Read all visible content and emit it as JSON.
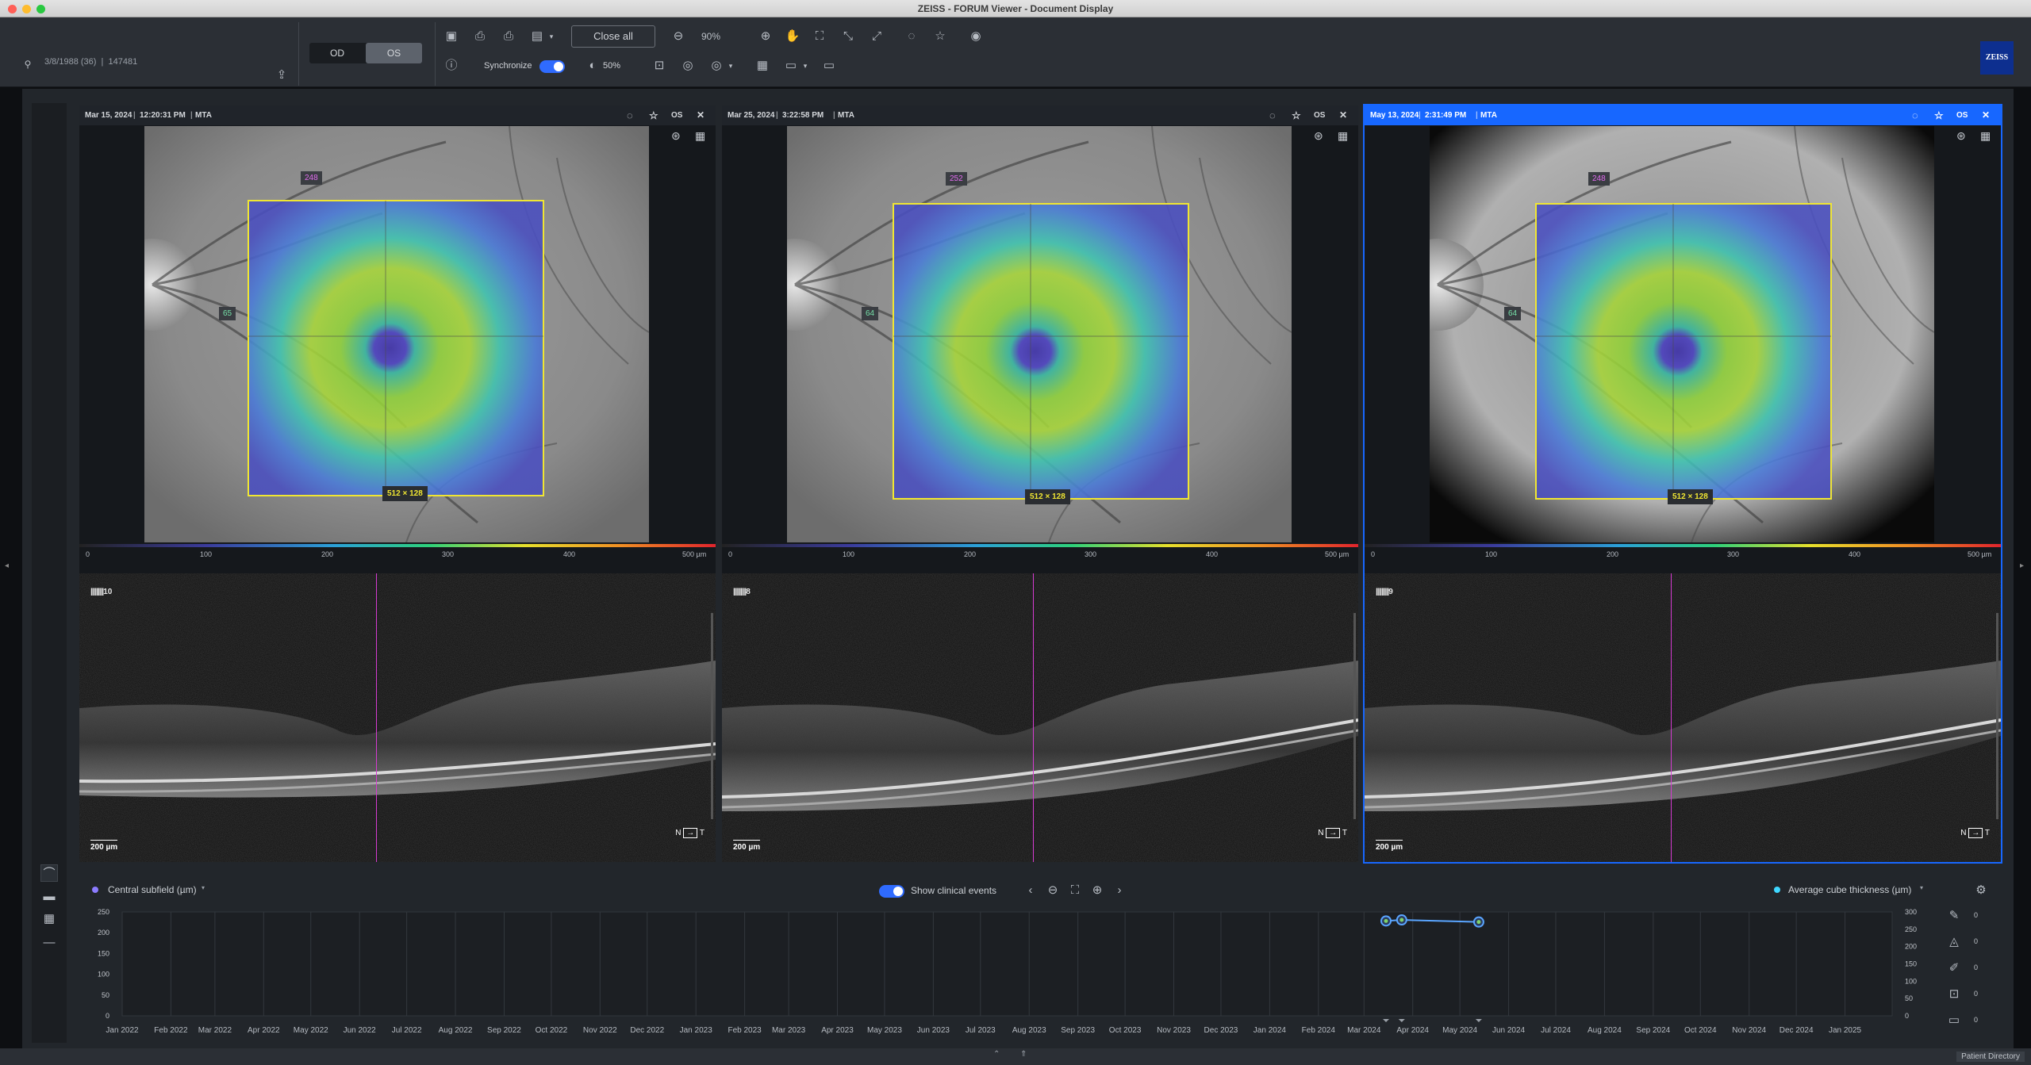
{
  "window": {
    "title": "ZEISS - FORUM Viewer - Document Display"
  },
  "patient": {
    "info": "3/8/1988 (36)  |  147481"
  },
  "eye_toggle": {
    "left": "OD",
    "right": "OS",
    "selected": "OS"
  },
  "toolbar": {
    "close_all": "Close all",
    "zoom": "90%",
    "synchronize": "Synchronize",
    "opacity": "50%"
  },
  "brand": {
    "logo": "ZEISS"
  },
  "panels": [
    {
      "date": "Mar 15, 2024",
      "time": "12:20:31 PM",
      "type": "MTA",
      "eye": "OS",
      "top_tag": "248",
      "left_tag": "65",
      "dim": "512 × 128",
      "bscan": "10",
      "selected": false
    },
    {
      "date": "Mar 25, 2024",
      "time": "3:22:58 PM",
      "type": "MTA",
      "eye": "OS",
      "top_tag": "252",
      "left_tag": "64",
      "dim": "512 × 128",
      "bscan": "8",
      "selected": false
    },
    {
      "date": "May 13, 2024",
      "time": "2:31:49 PM",
      "type": "MTA",
      "eye": "OS",
      "top_tag": "248",
      "left_tag": "64",
      "dim": "512 × 128",
      "bscan": "9",
      "selected": true
    }
  ],
  "scale_labels": [
    "0",
    "100",
    "200",
    "300",
    "400",
    "500 µm"
  ],
  "oct_scale": "200 µm",
  "oct_orient": {
    "n": "N",
    "t": "T"
  },
  "graph": {
    "left_series": "Central subfield (µm)",
    "right_series": "Average cube thickness (µm)",
    "show_clinical_events": "Show clinical events",
    "side_counts": [
      "0",
      "0",
      "0",
      "0",
      "0"
    ]
  },
  "status": {
    "patient_directory": "Patient Directory"
  },
  "colors": {
    "accent": "#1767ff",
    "map_border": "#f0e632",
    "marker": "#d63bd2",
    "series": "#5aa5ff"
  },
  "chart_data": {
    "type": "line",
    "x": [
      "Jan 2022",
      "Feb 2022",
      "Mar 2022",
      "Apr 2022",
      "May 2022",
      "Jun 2022",
      "Jul 2022",
      "Aug 2022",
      "Sep 2022",
      "Oct 2022",
      "Nov 2022",
      "Dec 2022",
      "Jan 2023",
      "Feb 2023",
      "Mar 2023",
      "Apr 2023",
      "May 2023",
      "Jun 2023",
      "Jul 2023",
      "Aug 2023",
      "Sep 2023",
      "Oct 2023",
      "Nov 2023",
      "Dec 2023",
      "Jan 2024",
      "Feb 2024",
      "Mar 2024",
      "Apr 2024",
      "May 2024",
      "Jun 2024",
      "Jul 2024",
      "Aug 2024",
      "Sep 2024",
      "Oct 2024",
      "Nov 2024",
      "Dec 2024",
      "Jan 2025"
    ],
    "yticks_left": [
      "250",
      "200",
      "150",
      "100",
      "50",
      "0"
    ],
    "yticks_right": [
      "300",
      "250",
      "200",
      "150",
      "100",
      "50",
      "0"
    ],
    "ylim": [
      0,
      250
    ],
    "series": [
      {
        "name": "Average cube thickness (µm)",
        "points": [
          {
            "x": "2024-03-15",
            "y": 274
          },
          {
            "x": "2024-03-25",
            "y": 277
          },
          {
            "x": "2024-05-13",
            "y": 271
          }
        ]
      }
    ],
    "x_start": "2022-01-01",
    "x_end": "2025-01-31",
    "y2lim": [
      0,
      300
    ]
  }
}
